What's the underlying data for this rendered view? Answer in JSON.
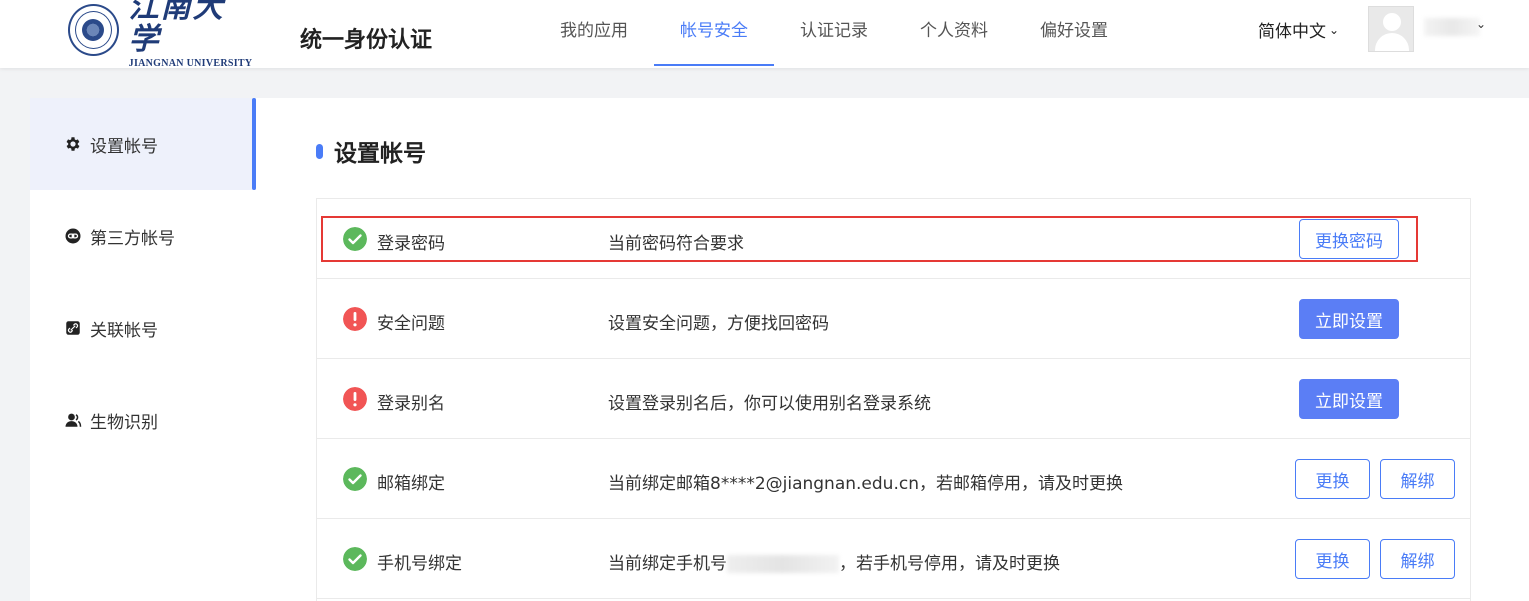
{
  "header": {
    "logo_cn": "江南大学",
    "logo_en": "JIANGNAN UNIVERSITY",
    "system_title": "统一身份认证",
    "nav": [
      {
        "label": "我的应用"
      },
      {
        "label": "帐号安全",
        "active": true
      },
      {
        "label": "认证记录"
      },
      {
        "label": "个人资料"
      },
      {
        "label": "偏好设置"
      }
    ],
    "language": "简体中文"
  },
  "sidebar": {
    "items": [
      {
        "label": "设置帐号",
        "icon": "gear-icon",
        "active": true
      },
      {
        "label": "第三方帐号",
        "icon": "link-icon"
      },
      {
        "label": "关联帐号",
        "icon": "linked-account-icon"
      },
      {
        "label": "生物识别",
        "icon": "user-icon"
      }
    ]
  },
  "main": {
    "title": "设置帐号",
    "rows": [
      {
        "label": "登录密码",
        "status": "ok",
        "description": "当前密码符合要求",
        "buttons": [
          "更换密码"
        ]
      },
      {
        "label": "安全问题",
        "status": "warning",
        "description": "设置安全问题，方便找回密码",
        "buttons": [
          "立即设置"
        ]
      },
      {
        "label": "登录别名",
        "status": "warning",
        "description": "设置登录别名后，你可以使用别名登录系统",
        "buttons": [
          "立即设置"
        ]
      },
      {
        "label": "邮箱绑定",
        "status": "ok",
        "description": "当前绑定邮箱8****2@jiangnan.edu.cn，若邮箱停用，请及时更换",
        "buttons": [
          "更换",
          "解绑"
        ]
      },
      {
        "label": "手机号绑定",
        "status": "ok",
        "description_prefix": "当前绑定手机号",
        "description_suffix": "，若手机号停用，请及时更换",
        "buttons": [
          "更换",
          "解绑"
        ]
      }
    ]
  },
  "colors": {
    "accent": "#4a7cf7",
    "ok": "#5cb85c",
    "warning": "#f15555",
    "highlight": "#e53935"
  }
}
